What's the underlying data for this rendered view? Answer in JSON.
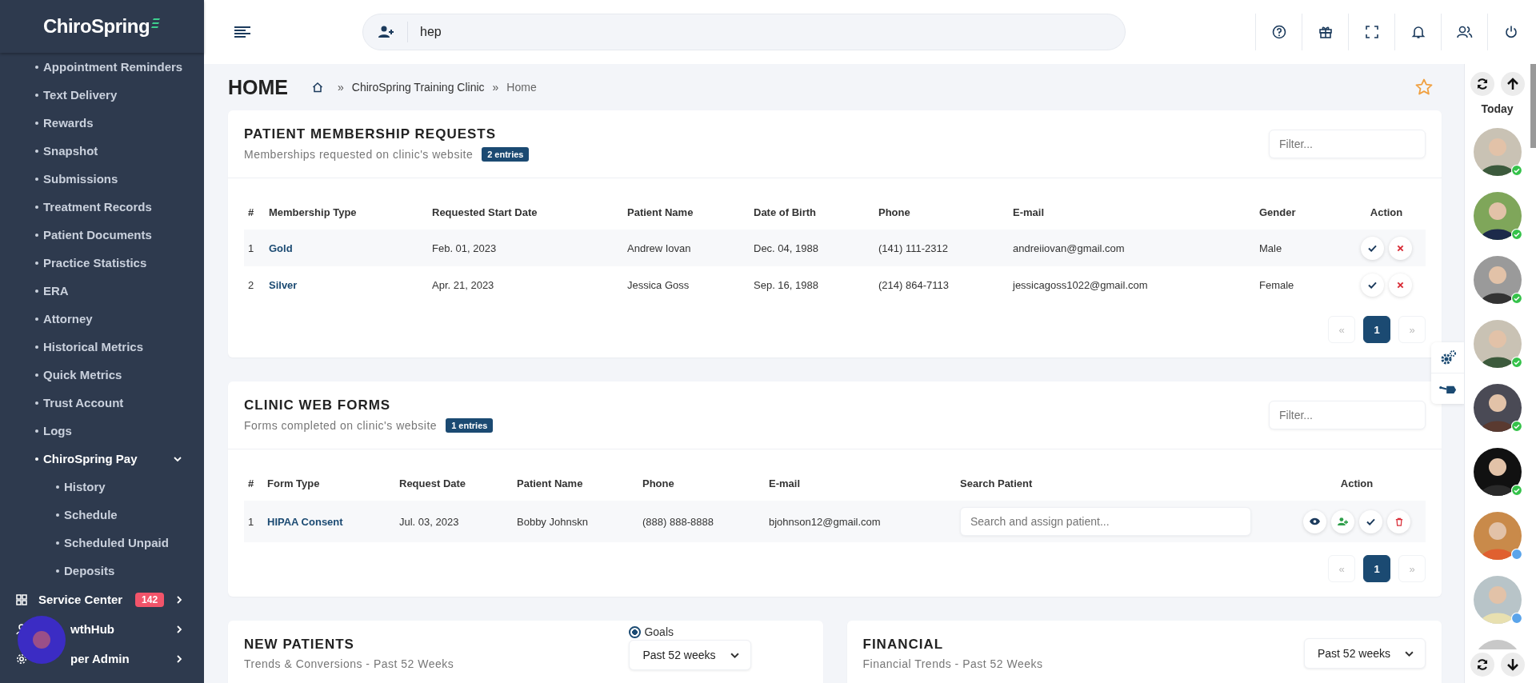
{
  "sidebar": {
    "logo": "ChiroSpring",
    "items": [
      {
        "label": "Appointment Reminders",
        "selected": false
      },
      {
        "label": "Text Delivery",
        "selected": false
      },
      {
        "label": "Rewards",
        "selected": false
      },
      {
        "label": "Snapshot",
        "selected": false
      },
      {
        "label": "Submissions",
        "selected": false
      },
      {
        "label": "Treatment Records",
        "selected": false
      },
      {
        "label": "Patient Documents",
        "selected": false
      },
      {
        "label": "Practice Statistics",
        "selected": false
      },
      {
        "label": "ERA",
        "selected": false
      },
      {
        "label": "Attorney",
        "selected": false
      },
      {
        "label": "Historical Metrics",
        "selected": false
      },
      {
        "label": "Quick Metrics",
        "selected": false
      },
      {
        "label": "Trust Account",
        "selected": false
      },
      {
        "label": "Logs",
        "selected": false
      },
      {
        "label": "ChiroSpring Pay",
        "selected": true,
        "expanded": true,
        "children": [
          {
            "label": "History",
            "selected": false
          },
          {
            "label": "Schedule",
            "selected": false
          },
          {
            "label": "Scheduled Unpaid",
            "selected": false
          },
          {
            "label": "Deposits",
            "selected": false
          }
        ]
      }
    ],
    "sections": [
      {
        "kind": "grid",
        "label": "Service Center",
        "badge": "142"
      },
      {
        "kind": "person",
        "label": "wthHub"
      },
      {
        "kind": "gear",
        "label": "per Admin"
      }
    ]
  },
  "header": {
    "search": {
      "value": "hep"
    }
  },
  "page": {
    "title": "HOME",
    "separator": "»",
    "breadcrumb": [
      "ChiroSpring Training Clinic",
      "Home"
    ]
  },
  "membership_requests": {
    "title": "PATIENT MEMBERSHIP REQUESTS",
    "subtitle": "Memberships requested on clinic's website",
    "badge": "2 entries",
    "filter": {
      "placeholder": "Filter..."
    },
    "columns": [
      "#",
      "Membership Type",
      "Requested Start Date",
      "Patient Name",
      "Date of Birth",
      "Phone",
      "E-mail",
      "Gender",
      "Action"
    ],
    "rows": [
      {
        "cells": [
          "1",
          "Gold",
          "Feb. 01, 2023",
          "Andrew Iovan",
          "Dec. 04, 1988",
          "(141) 111-2312",
          "andreiiovan@gmail.com",
          "Male"
        ]
      },
      {
        "cells": [
          "2",
          "Silver",
          "Apr. 21, 2023",
          "Jessica Goss",
          "Sep. 16, 1988",
          "(214) 864-7113",
          "jessicagoss1022@gmail.com",
          "Female"
        ]
      }
    ],
    "pagination": [
      {
        "label": "«",
        "selected": false,
        "disabled": true
      },
      {
        "label": "1",
        "selected": true,
        "disabled": false
      },
      {
        "label": "»",
        "selected": false,
        "disabled": true
      }
    ]
  },
  "web_forms": {
    "title": "CLINIC WEB FORMS",
    "subtitle": "Forms completed on clinic's website",
    "badge": "1 entries",
    "filter": {
      "placeholder": "Filter..."
    },
    "columns": [
      "#",
      "Form Type",
      "Request Date",
      "Patient Name",
      "Phone",
      "E-mail",
      "Search Patient",
      "Action"
    ],
    "rows": [
      {
        "cells": [
          "1",
          "HIPAA Consent",
          "Jul. 03, 2023",
          "Bobby Johnskn",
          "(888) 888-8888",
          "bjohnson12@gmail.com"
        ],
        "search": {
          "placeholder": "Search and assign patient..."
        }
      }
    ],
    "pagination": [
      {
        "label": "«",
        "selected": false,
        "disabled": true
      },
      {
        "label": "1",
        "selected": true,
        "disabled": false
      },
      {
        "label": "»",
        "selected": false,
        "disabled": true
      }
    ]
  },
  "new_patients": {
    "title": "NEW PATIENTS",
    "subtitle": "Trends & Conversions - Past 52 Weeks",
    "goals": {
      "label": "Goals",
      "checked": true
    },
    "range": "Past 52 weeks"
  },
  "financial": {
    "title": "FINANCIAL",
    "subtitle": "Financial Trends - Past 52 Weeks",
    "range": "Past 52 weeks"
  },
  "today": {
    "label": "Today",
    "avatars": [
      {
        "confirmed": true
      },
      {
        "confirmed": true
      },
      {
        "confirmed": true
      },
      {
        "confirmed": true
      },
      {
        "confirmed": true
      },
      {
        "confirmed": true
      },
      {
        "confirmed": false
      },
      {
        "confirmed": false
      }
    ]
  }
}
